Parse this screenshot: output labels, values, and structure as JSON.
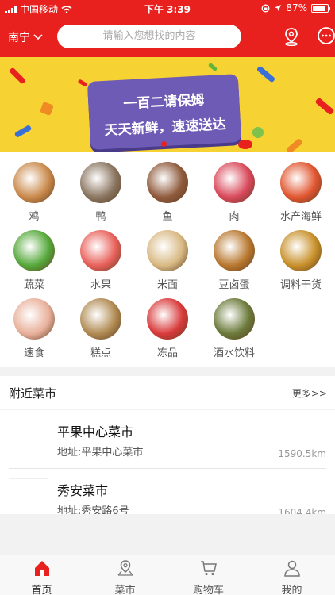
{
  "status_bar": {
    "carrier": "中国移动",
    "time": "下午 3:39",
    "battery": "87%"
  },
  "header": {
    "city": "南宁",
    "search_placeholder": "请输入您想找的内容",
    "icons": [
      "location-icon",
      "message-icon"
    ]
  },
  "banner": {
    "line1": "一百二请保姆",
    "line2": "天天新鲜，速速送达"
  },
  "categories": [
    {
      "label": "鸡",
      "color": "#c9894a"
    },
    {
      "label": "鸭",
      "color": "#8a7560"
    },
    {
      "label": "鱼",
      "color": "#8f5a3c"
    },
    {
      "label": "肉",
      "color": "#d9485a"
    },
    {
      "label": "水产海鲜",
      "color": "#e0552f"
    },
    {
      "label": "蔬菜",
      "color": "#55a83a"
    },
    {
      "label": "水果",
      "color": "#e8605a"
    },
    {
      "label": "米面",
      "color": "#d8b983"
    },
    {
      "label": "豆卤蛋",
      "color": "#b8772e"
    },
    {
      "label": "调料干货",
      "color": "#c8902a"
    },
    {
      "label": "速食",
      "color": "#e8b09a"
    },
    {
      "label": "糕点",
      "color": "#b08a52"
    },
    {
      "label": "冻品",
      "color": "#d93a3a"
    },
    {
      "label": "酒水饮料",
      "color": "#6b7a3a"
    }
  ],
  "nearby": {
    "title": "附近菜市",
    "more": "更多>>",
    "markets": [
      {
        "name": "平果中心菜市",
        "address": "地址:平果中心菜市",
        "distance": "1590.5km"
      },
      {
        "name": "秀安菜市",
        "address": "地址:秀安路6号",
        "distance": "1604.4km"
      }
    ]
  },
  "tabbar": {
    "items": [
      {
        "label": "首页",
        "icon": "home-icon"
      },
      {
        "label": "菜市",
        "icon": "map-pin-icon"
      },
      {
        "label": "购物车",
        "icon": "cart-icon"
      },
      {
        "label": "我的",
        "icon": "user-icon"
      }
    ]
  },
  "colors": {
    "brand_red": "#e8211f",
    "banner_yellow": "#f7d233",
    "sign_purple": "#6e5bb5"
  }
}
